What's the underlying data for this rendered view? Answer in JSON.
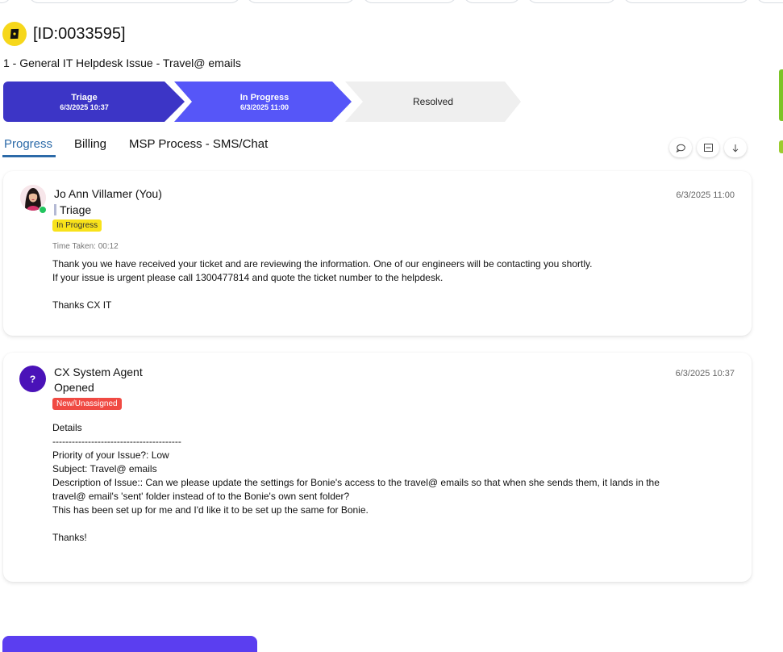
{
  "ticket": {
    "id_label": "[ID:0033595]",
    "title": "1 - General IT Helpdesk Issue - Travel@ emails",
    "icon": "ticket-icon"
  },
  "stages": [
    {
      "label": "Triage",
      "date": "6/3/2025 10:37",
      "color": "#3c35c6"
    },
    {
      "label": "In Progress",
      "date": "6/3/2025 11:00",
      "color": "#5656f8"
    },
    {
      "label": "Resolved",
      "date": "",
      "color": "#efefef"
    }
  ],
  "tabs": [
    {
      "label": "Progress",
      "active": true
    },
    {
      "label": "Billing",
      "active": false
    },
    {
      "label": "MSP Process - SMS/Chat",
      "active": false
    }
  ],
  "actions": [
    {
      "icon": "comment-icon",
      "glyph": "◯"
    },
    {
      "icon": "note-icon",
      "glyph": "▭"
    },
    {
      "icon": "arrow-down-icon",
      "glyph": "↓"
    }
  ],
  "entries": [
    {
      "author": "Jo Ann Villamer (You)",
      "status": "Triage",
      "badge": "In Progress",
      "badge_color": "#f8e21a",
      "time_taken": "Time Taken: 00:12",
      "timestamp": "6/3/2025 11:00",
      "body": "Thank you we have received your ticket and are reviewing the information. One of our engineers will be contacting you shortly.\nIf your issue is urgent please call 1300477814 and quote the ticket number to the helpdesk.\n\nThanks CX IT"
    },
    {
      "author": "CX System Agent",
      "avatar_initial": "?",
      "status": "Opened",
      "badge": "New/Unassigned",
      "badge_color": "#f04a43",
      "timestamp": "6/3/2025 10:37",
      "body": "Details\n----------------------------------------\nPriority of your Issue?: Low\nSubject: Travel@ emails\nDescription of Issue:: Can we please update the settings for Bonie's access to the travel@ emails so that when she sends them, it lands in the\ntravel@ email's 'sent' folder instead of to the Bonie's own sent folder?\nThis has been set up for me and I'd like it to be set up the same for Bonie.\n\nThanks!"
    }
  ],
  "colors": {
    "accent": "#2c6aa8",
    "brand_purple": "#5b3ef0",
    "right_edge_green": "#7cc427"
  }
}
